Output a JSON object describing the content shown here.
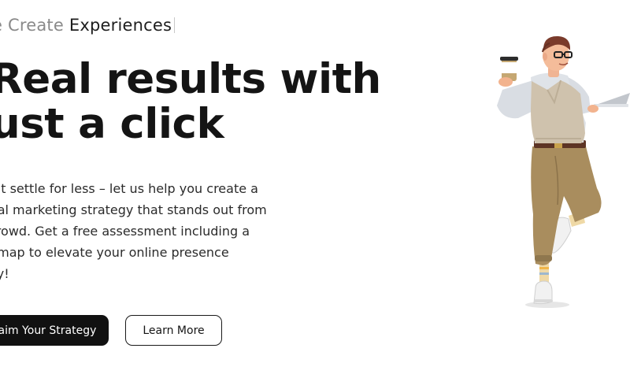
{
  "hero": {
    "tagline_prefix": "e Create",
    "tagline_highlight": "Experiences",
    "headline_line1": "Real results with",
    "headline_line2": "ust a click",
    "body_lines": [
      "n’t settle for less – let us help you create a",
      "ital marketing strategy that stands out from",
      " crowd. Get a free assessment including a",
      "dmap to elevate your online presence",
      "ay!"
    ]
  },
  "buttons": {
    "primary_label": "laim Your Strategy",
    "secondary_label": "Learn More"
  },
  "illustration": {
    "icon": "man-with-coffee-and-laptop-illustration"
  }
}
